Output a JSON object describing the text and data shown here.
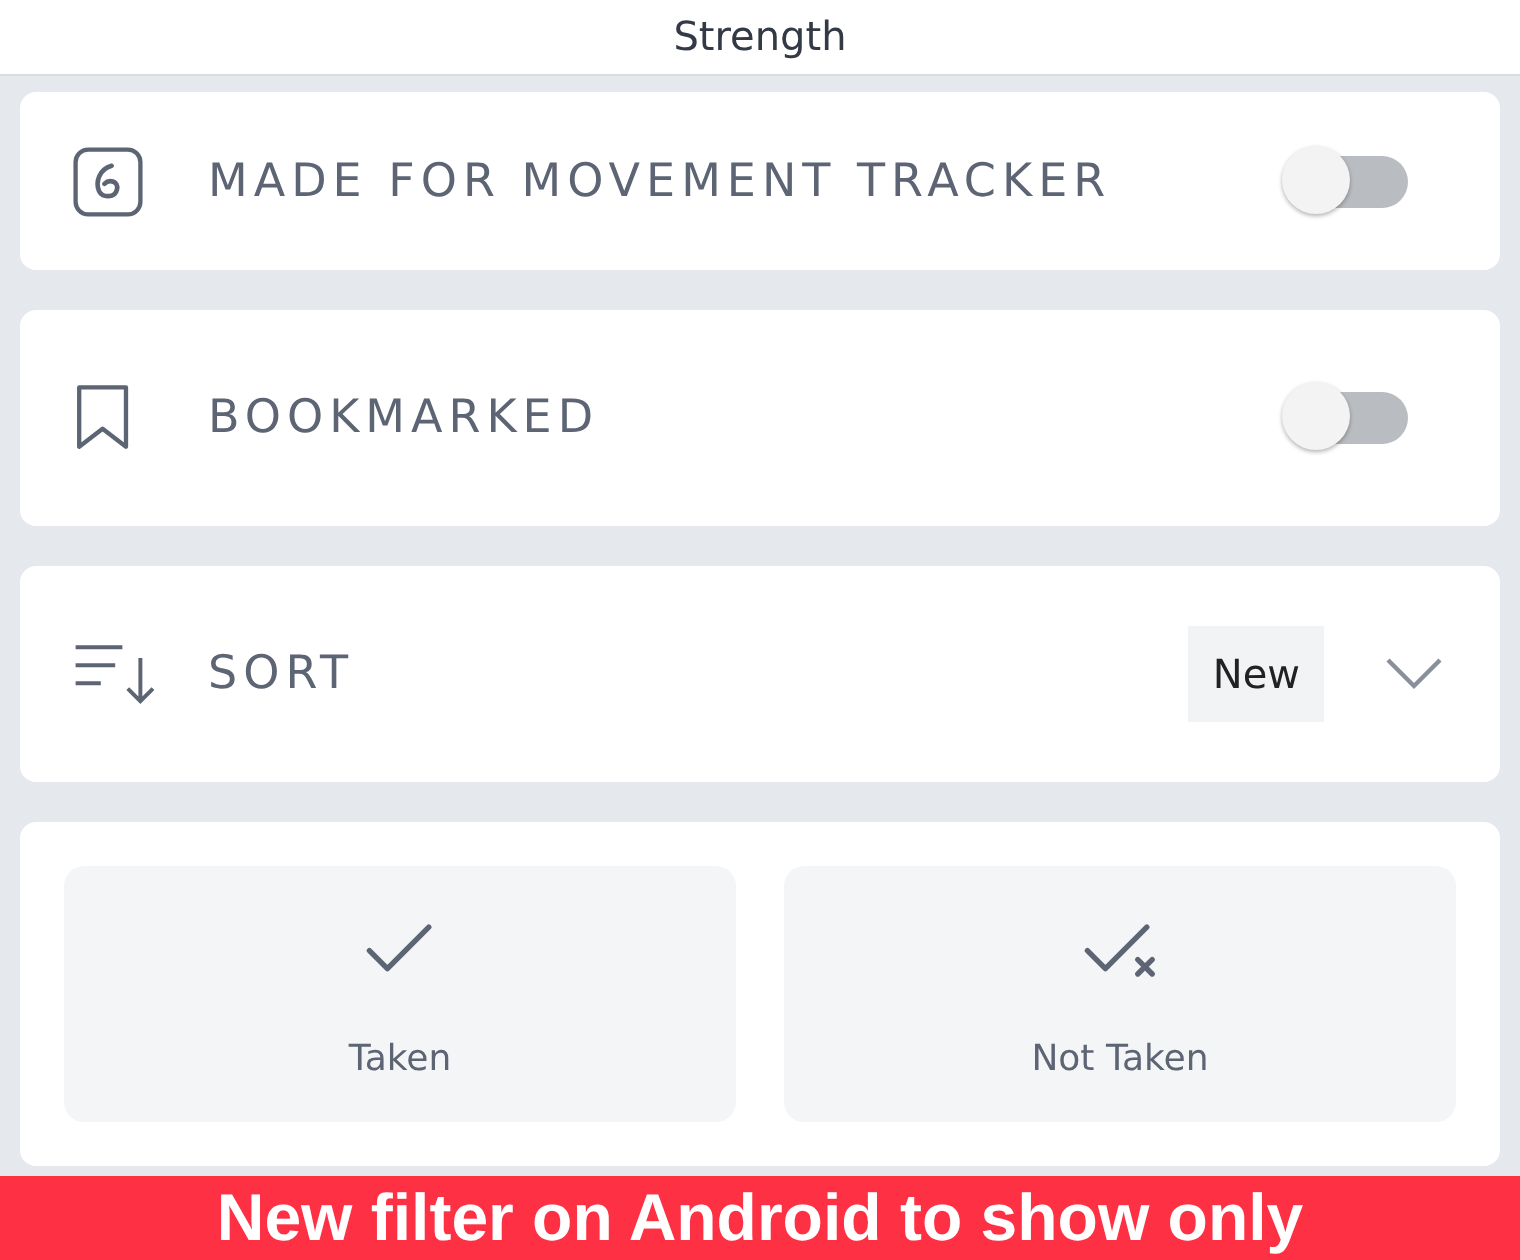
{
  "header": {
    "title": "Strength"
  },
  "filters": [
    {
      "kind": "toggle",
      "label": "MADE FOR MOVEMENT TRACKER",
      "on": false
    },
    {
      "kind": "toggle",
      "label": "BOOKMARKED",
      "on": false
    },
    {
      "kind": "sort",
      "label": "SORT",
      "value": "New"
    }
  ],
  "status_options": [
    {
      "label": "Taken",
      "selected": false
    },
    {
      "label": "Not Taken",
      "selected": false
    }
  ],
  "caption": "New filter on Android to show only"
}
